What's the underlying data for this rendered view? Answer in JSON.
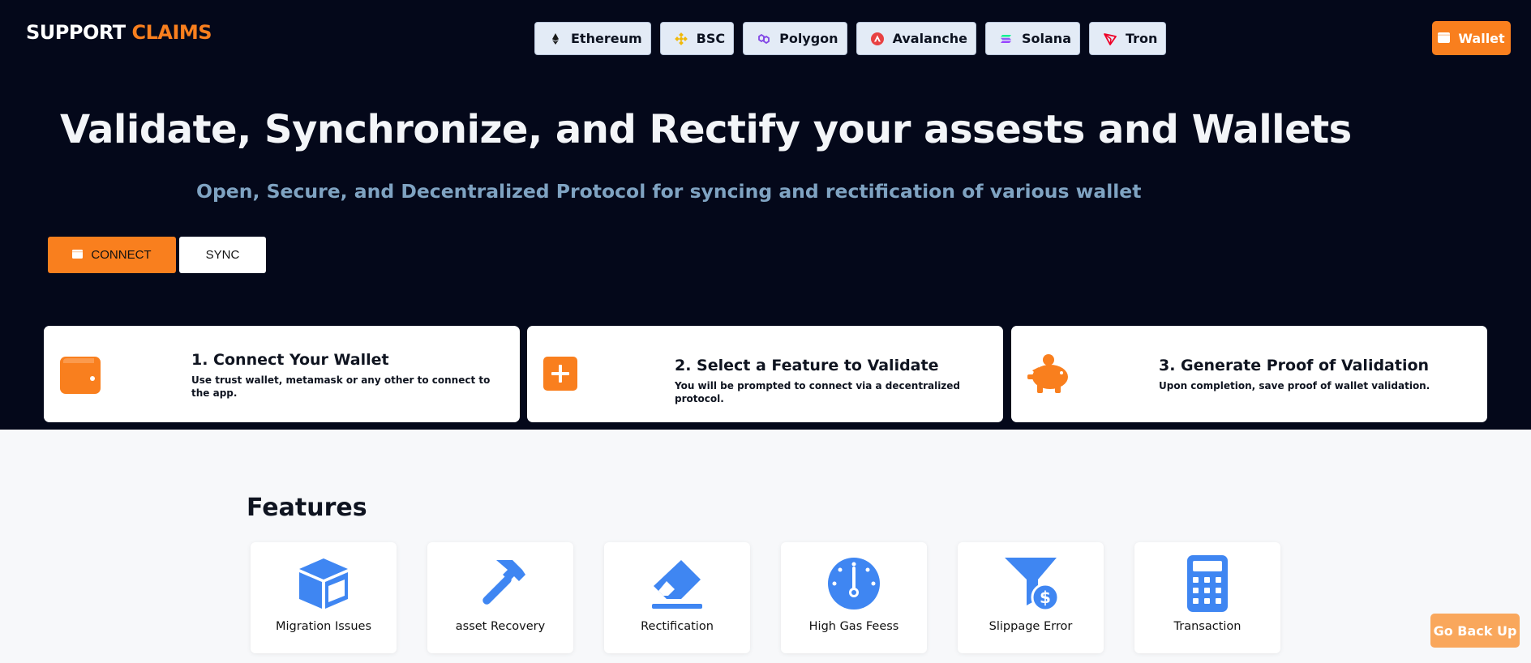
{
  "brand": {
    "part1": "SUPPORT",
    "part2": "CLAIMS"
  },
  "chains": [
    {
      "label": "Ethereum",
      "icon": "ethereum-icon"
    },
    {
      "label": "BSC",
      "icon": "bsc-icon"
    },
    {
      "label": "Polygon",
      "icon": "polygon-icon"
    },
    {
      "label": "Avalanche",
      "icon": "avalanche-icon"
    },
    {
      "label": "Solana",
      "icon": "solana-icon"
    },
    {
      "label": "Tron",
      "icon": "tron-icon"
    }
  ],
  "header": {
    "wallet_label": "Wallet"
  },
  "hero": {
    "title": "Validate, Synchronize, and Rectify your assests and Wallets",
    "subtitle": "Open, Secure, and Decentralized Protocol for syncing and rectification of various wallet",
    "connect_label": "CONNECT",
    "sync_label": "SYNC"
  },
  "steps": [
    {
      "title": "1. Connect Your Wallet",
      "text": "Use trust wallet, metamask or any other to connect to the app.",
      "icon": "wallet-icon"
    },
    {
      "title": "2. Select a Feature to Validate",
      "text": "You will be prompted to connect via a decentralized protocol.",
      "icon": "plus-square-icon"
    },
    {
      "title": "3. Generate Proof of Validation",
      "text": "Upon completion, save proof of wallet validation.",
      "icon": "piggy-bank-icon"
    }
  ],
  "features": {
    "title": "Features",
    "items": [
      {
        "label": "Migration Issues",
        "icon": "cube-icon"
      },
      {
        "label": "asset Recovery",
        "icon": "hammer-icon"
      },
      {
        "label": "Rectification",
        "icon": "eraser-icon"
      },
      {
        "label": "High Gas Feess",
        "icon": "gauge-icon"
      },
      {
        "label": "Slippage Error",
        "icon": "funnel-dollar-icon"
      },
      {
        "label": "Transaction",
        "icon": "calculator-icon"
      }
    ]
  },
  "go_back_label": "Go Back Up",
  "colors": {
    "accent": "#f97f1e",
    "hero_bg": "#04081a",
    "feature_blue": "#3f86f2",
    "chain_bg": "#e3ebf6"
  }
}
